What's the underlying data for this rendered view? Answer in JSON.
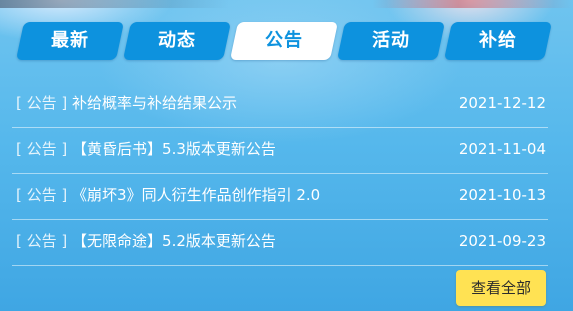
{
  "tabs": [
    {
      "label": "最新",
      "active": false
    },
    {
      "label": "动态",
      "active": false
    },
    {
      "label": "公告",
      "active": true
    },
    {
      "label": "活动",
      "active": false
    },
    {
      "label": "补给",
      "active": false
    }
  ],
  "announcements": [
    {
      "tag": "[ 公告 ]",
      "title": "补给概率与补给结果公示",
      "date": "2021-12-12"
    },
    {
      "tag": "[ 公告 ]",
      "title": "【黄昏后书】5.3版本更新公告",
      "date": "2021-11-04"
    },
    {
      "tag": "[ 公告 ]",
      "title": "《崩坏3》同人衍生作品创作指引 2.0",
      "date": "2021-10-13"
    },
    {
      "tag": "[ 公告 ]",
      "title": "【无限命途】5.2版本更新公告",
      "date": "2021-09-23"
    }
  ],
  "view_all_label": "查看全部",
  "colors": {
    "tab_bg": "#0d92de",
    "tab_active_bg": "#ffffff",
    "tab_active_text": "#0d92de",
    "button_bg": "#ffe253"
  }
}
